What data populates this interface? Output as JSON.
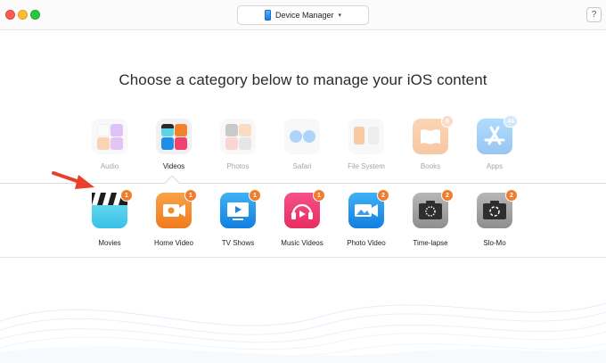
{
  "window": {
    "device_label": "Device Manager",
    "help_label": "?"
  },
  "heading": "Choose a category below to manage your iOS content",
  "categories": [
    {
      "label": "Audio"
    },
    {
      "label": "Videos"
    },
    {
      "label": "Photos"
    },
    {
      "label": "Safari"
    },
    {
      "label": "File System"
    },
    {
      "label": "Books",
      "badge": "6"
    },
    {
      "label": "Apps",
      "badge": "44"
    }
  ],
  "video_items": [
    {
      "label": "Movies",
      "badge": "1"
    },
    {
      "label": "Home Video",
      "badge": "1"
    },
    {
      "label": "TV Shows",
      "badge": "1"
    },
    {
      "label": "Music Videos",
      "badge": "1"
    },
    {
      "label": "Photo Video",
      "badge": "2"
    },
    {
      "label": "Time-lapse",
      "badge": "2"
    },
    {
      "label": "Slo-Mo",
      "badge": "2"
    }
  ],
  "colors": {
    "accent_badge": "#f07c2e",
    "active_category": "#222222",
    "inactive_category": "#a6a6a6",
    "annotation_arrow": "#e8402a"
  }
}
